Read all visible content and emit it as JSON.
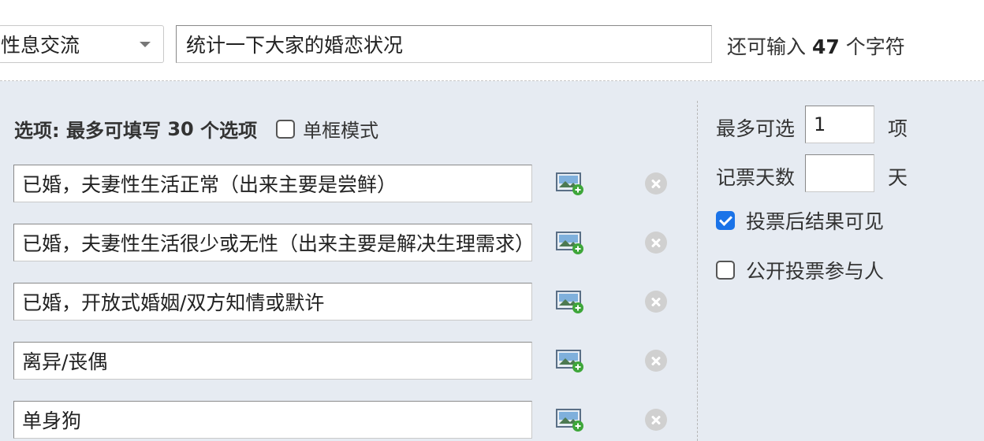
{
  "topbar": {
    "category_value": "性息交流",
    "subject_value": "统计一下大家的婚恋状况",
    "char_count_prefix": "还可输入",
    "char_count_number": "47",
    "char_count_suffix": "个字符"
  },
  "options_header": {
    "label": "选项:",
    "max_prefix": "最多可填写",
    "max_number": "30",
    "max_suffix": "个选项",
    "single_mode_label": "单框模式",
    "single_mode_checked": false
  },
  "options": [
    {
      "value": "已婚，夫妻性生活正常（出来主要是尝鲜）"
    },
    {
      "value": "已婚，夫妻性生活很少或无性（出来主要是解决生理需求）"
    },
    {
      "value": "已婚，开放式婚姻/双方知情或默许"
    },
    {
      "value": "离异/丧偶"
    },
    {
      "value": "单身狗"
    }
  ],
  "settings": {
    "max_select_label": "最多可选",
    "max_select_value": "1",
    "max_select_unit": "项",
    "days_label": "记票天数",
    "days_value": "",
    "days_unit": "天",
    "show_after_vote_label": "投票后结果可见",
    "show_after_vote_checked": true,
    "public_voters_label": "公开投票参与人",
    "public_voters_checked": false
  },
  "icons": {
    "image_button": "add-image-icon",
    "delete_button": "close-circle-icon",
    "select_caret": "chevron-down-icon"
  },
  "colors": {
    "panel_bg": "#e6ebf2",
    "checkbox_checked": "#1a73e8"
  }
}
